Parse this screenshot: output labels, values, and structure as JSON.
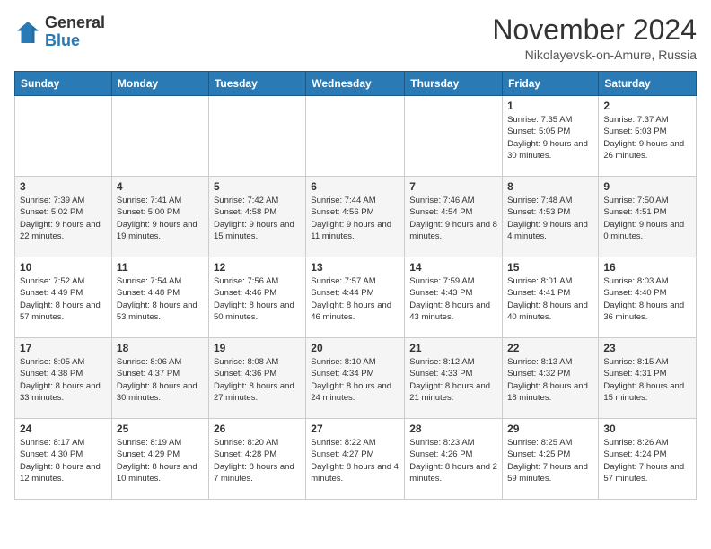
{
  "logo": {
    "general": "General",
    "blue": "Blue"
  },
  "header": {
    "month_year": "November 2024",
    "location": "Nikolayevsk-on-Amure, Russia"
  },
  "days_of_week": [
    "Sunday",
    "Monday",
    "Tuesday",
    "Wednesday",
    "Thursday",
    "Friday",
    "Saturday"
  ],
  "weeks": [
    [
      {
        "day": "",
        "info": ""
      },
      {
        "day": "",
        "info": ""
      },
      {
        "day": "",
        "info": ""
      },
      {
        "day": "",
        "info": ""
      },
      {
        "day": "",
        "info": ""
      },
      {
        "day": "1",
        "info": "Sunrise: 7:35 AM\nSunset: 5:05 PM\nDaylight: 9 hours and 30 minutes."
      },
      {
        "day": "2",
        "info": "Sunrise: 7:37 AM\nSunset: 5:03 PM\nDaylight: 9 hours and 26 minutes."
      }
    ],
    [
      {
        "day": "3",
        "info": "Sunrise: 7:39 AM\nSunset: 5:02 PM\nDaylight: 9 hours and 22 minutes."
      },
      {
        "day": "4",
        "info": "Sunrise: 7:41 AM\nSunset: 5:00 PM\nDaylight: 9 hours and 19 minutes."
      },
      {
        "day": "5",
        "info": "Sunrise: 7:42 AM\nSunset: 4:58 PM\nDaylight: 9 hours and 15 minutes."
      },
      {
        "day": "6",
        "info": "Sunrise: 7:44 AM\nSunset: 4:56 PM\nDaylight: 9 hours and 11 minutes."
      },
      {
        "day": "7",
        "info": "Sunrise: 7:46 AM\nSunset: 4:54 PM\nDaylight: 9 hours and 8 minutes."
      },
      {
        "day": "8",
        "info": "Sunrise: 7:48 AM\nSunset: 4:53 PM\nDaylight: 9 hours and 4 minutes."
      },
      {
        "day": "9",
        "info": "Sunrise: 7:50 AM\nSunset: 4:51 PM\nDaylight: 9 hours and 0 minutes."
      }
    ],
    [
      {
        "day": "10",
        "info": "Sunrise: 7:52 AM\nSunset: 4:49 PM\nDaylight: 8 hours and 57 minutes."
      },
      {
        "day": "11",
        "info": "Sunrise: 7:54 AM\nSunset: 4:48 PM\nDaylight: 8 hours and 53 minutes."
      },
      {
        "day": "12",
        "info": "Sunrise: 7:56 AM\nSunset: 4:46 PM\nDaylight: 8 hours and 50 minutes."
      },
      {
        "day": "13",
        "info": "Sunrise: 7:57 AM\nSunset: 4:44 PM\nDaylight: 8 hours and 46 minutes."
      },
      {
        "day": "14",
        "info": "Sunrise: 7:59 AM\nSunset: 4:43 PM\nDaylight: 8 hours and 43 minutes."
      },
      {
        "day": "15",
        "info": "Sunrise: 8:01 AM\nSunset: 4:41 PM\nDaylight: 8 hours and 40 minutes."
      },
      {
        "day": "16",
        "info": "Sunrise: 8:03 AM\nSunset: 4:40 PM\nDaylight: 8 hours and 36 minutes."
      }
    ],
    [
      {
        "day": "17",
        "info": "Sunrise: 8:05 AM\nSunset: 4:38 PM\nDaylight: 8 hours and 33 minutes."
      },
      {
        "day": "18",
        "info": "Sunrise: 8:06 AM\nSunset: 4:37 PM\nDaylight: 8 hours and 30 minutes."
      },
      {
        "day": "19",
        "info": "Sunrise: 8:08 AM\nSunset: 4:36 PM\nDaylight: 8 hours and 27 minutes."
      },
      {
        "day": "20",
        "info": "Sunrise: 8:10 AM\nSunset: 4:34 PM\nDaylight: 8 hours and 24 minutes."
      },
      {
        "day": "21",
        "info": "Sunrise: 8:12 AM\nSunset: 4:33 PM\nDaylight: 8 hours and 21 minutes."
      },
      {
        "day": "22",
        "info": "Sunrise: 8:13 AM\nSunset: 4:32 PM\nDaylight: 8 hours and 18 minutes."
      },
      {
        "day": "23",
        "info": "Sunrise: 8:15 AM\nSunset: 4:31 PM\nDaylight: 8 hours and 15 minutes."
      }
    ],
    [
      {
        "day": "24",
        "info": "Sunrise: 8:17 AM\nSunset: 4:30 PM\nDaylight: 8 hours and 12 minutes."
      },
      {
        "day": "25",
        "info": "Sunrise: 8:19 AM\nSunset: 4:29 PM\nDaylight: 8 hours and 10 minutes."
      },
      {
        "day": "26",
        "info": "Sunrise: 8:20 AM\nSunset: 4:28 PM\nDaylight: 8 hours and 7 minutes."
      },
      {
        "day": "27",
        "info": "Sunrise: 8:22 AM\nSunset: 4:27 PM\nDaylight: 8 hours and 4 minutes."
      },
      {
        "day": "28",
        "info": "Sunrise: 8:23 AM\nSunset: 4:26 PM\nDaylight: 8 hours and 2 minutes."
      },
      {
        "day": "29",
        "info": "Sunrise: 8:25 AM\nSunset: 4:25 PM\nDaylight: 7 hours and 59 minutes."
      },
      {
        "day": "30",
        "info": "Sunrise: 8:26 AM\nSunset: 4:24 PM\nDaylight: 7 hours and 57 minutes."
      }
    ]
  ]
}
